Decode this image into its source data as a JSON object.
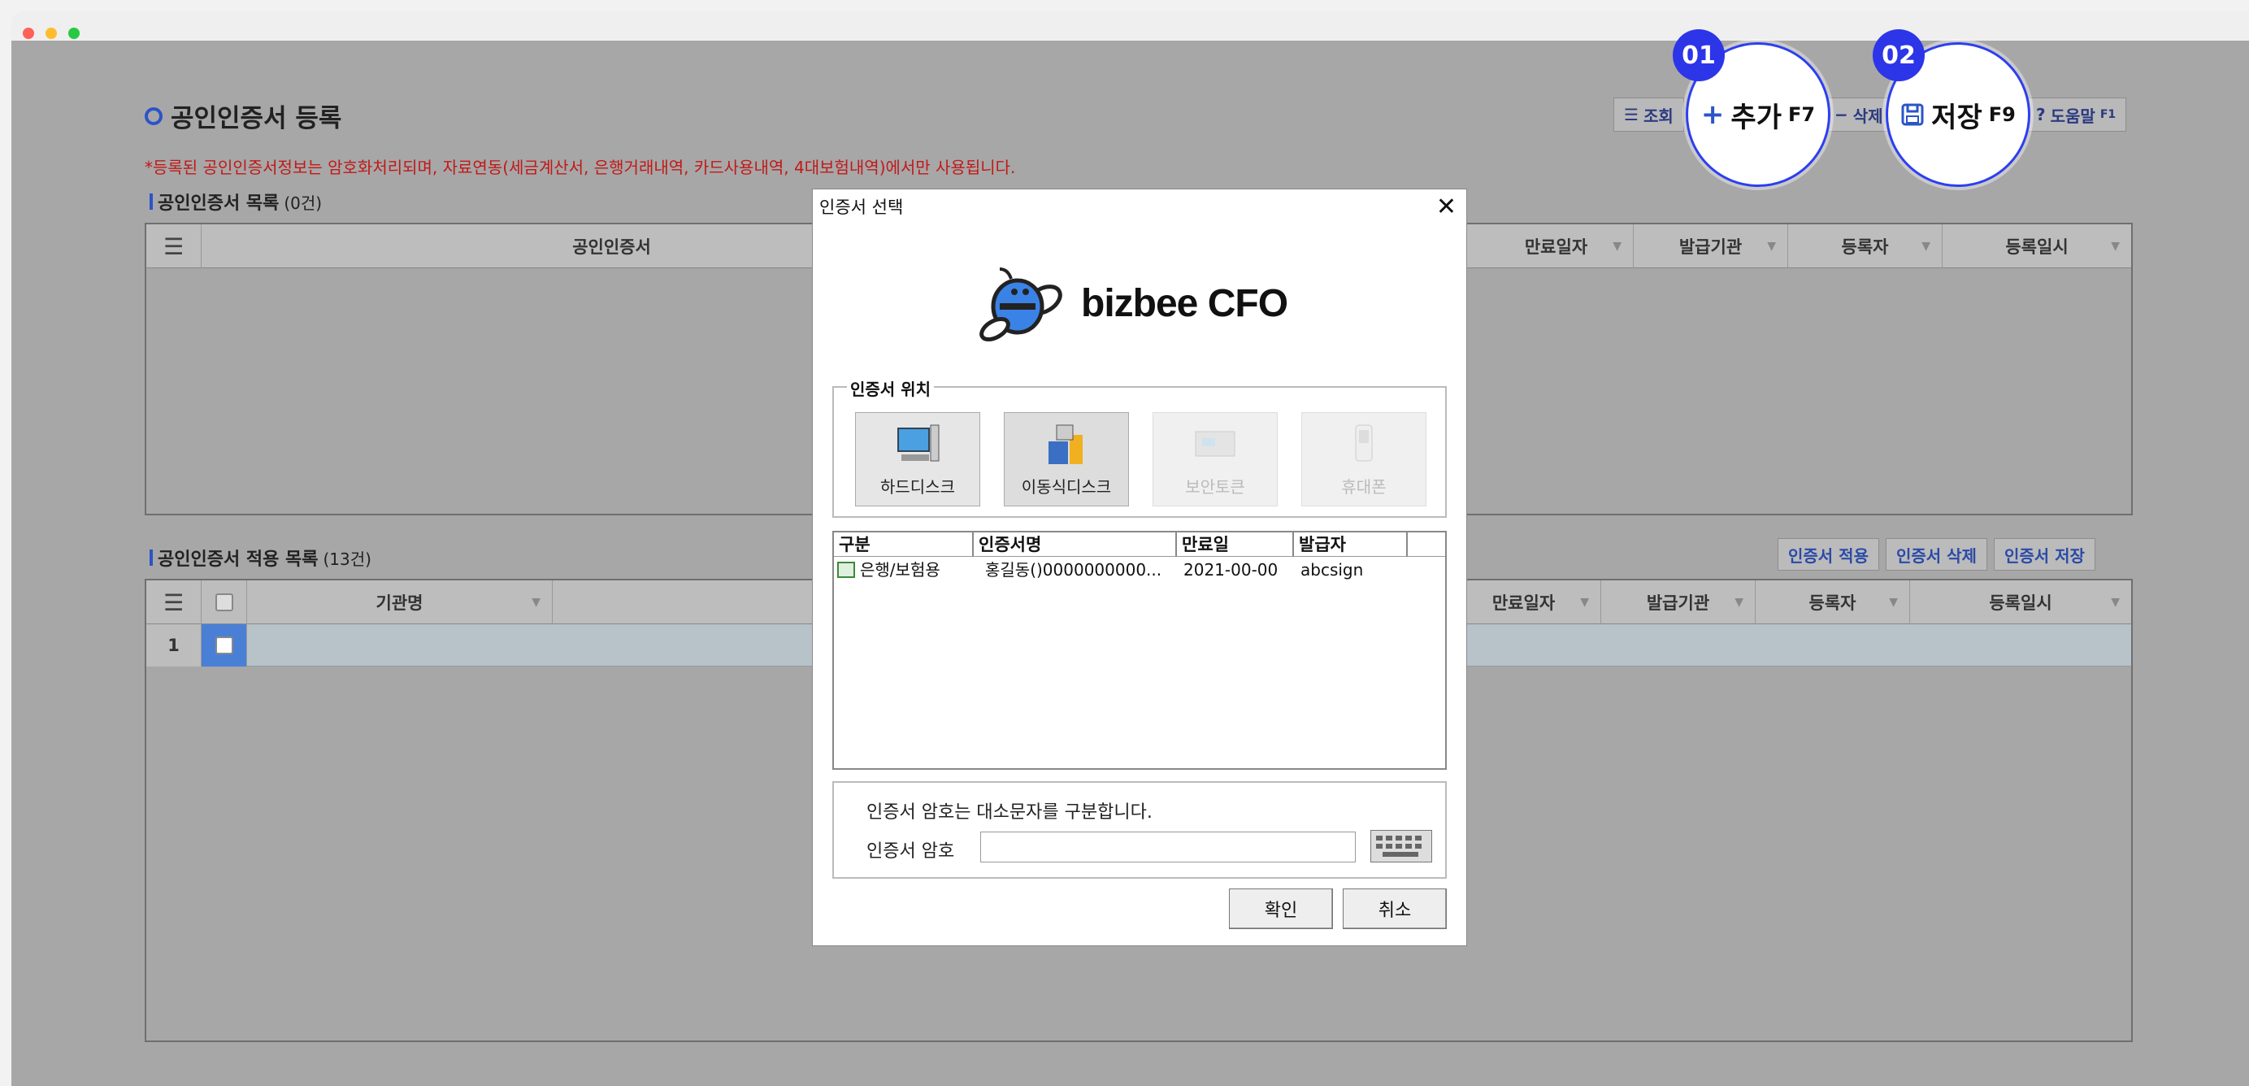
{
  "window": {
    "dots": [
      "#ff6159",
      "#ffbd2e",
      "#28c941"
    ]
  },
  "page": {
    "title": "공인인증서 등록",
    "notice": "*등록된 공인인증서정보는 암호화처리되며, 자료연동(세금계산서, 은행거래내역, 카드사용내역, 4대보험내역)에서만 사용됩니다."
  },
  "toolbar": {
    "search": "조회",
    "add": "추가",
    "add_key": "F7",
    "delete": "삭제",
    "save": "저장",
    "save_key": "F9",
    "help": "도움말",
    "help_key": "F1"
  },
  "callouts": {
    "one": "01",
    "two": "02"
  },
  "list1": {
    "title": "공인인증서 목록",
    "count": "(0건)",
    "cols": [
      "공인인증서",
      "만료일자",
      "발급기관",
      "등록자",
      "등록일시"
    ]
  },
  "list2": {
    "title": "공인인증서 적용 목록",
    "count": "(13건)",
    "cols": [
      "기관명",
      "만료일자",
      "발급기관",
      "등록자",
      "등록일시"
    ],
    "row_no": "1"
  },
  "list2_buttons": {
    "apply": "인증서 적용",
    "delete": "인증서 삭제",
    "save": "인증서 저장"
  },
  "dialog": {
    "title": "인증서 선택",
    "brand": "bizbee CFO",
    "location_legend": "인증서 위치",
    "locations": [
      "하드디스크",
      "이동식디스크",
      "보안토큰",
      "휴대폰"
    ],
    "cols": [
      "구분",
      "인증서명",
      "만료일",
      "발급자"
    ],
    "row": {
      "type": "은행/보험용",
      "name": "홍길동()0000000000...",
      "expiry": "2021-00-00",
      "issuer": "abcsign"
    },
    "pw_note": "인증서 암호는 대소문자를 구분합니다.",
    "pw_label": "인증서 암호",
    "pw_value": "",
    "ok": "확인",
    "cancel": "취소"
  },
  "colors": {
    "accent": "#2b54c8",
    "callout": "#2d35e8",
    "notice": "#c21818"
  }
}
